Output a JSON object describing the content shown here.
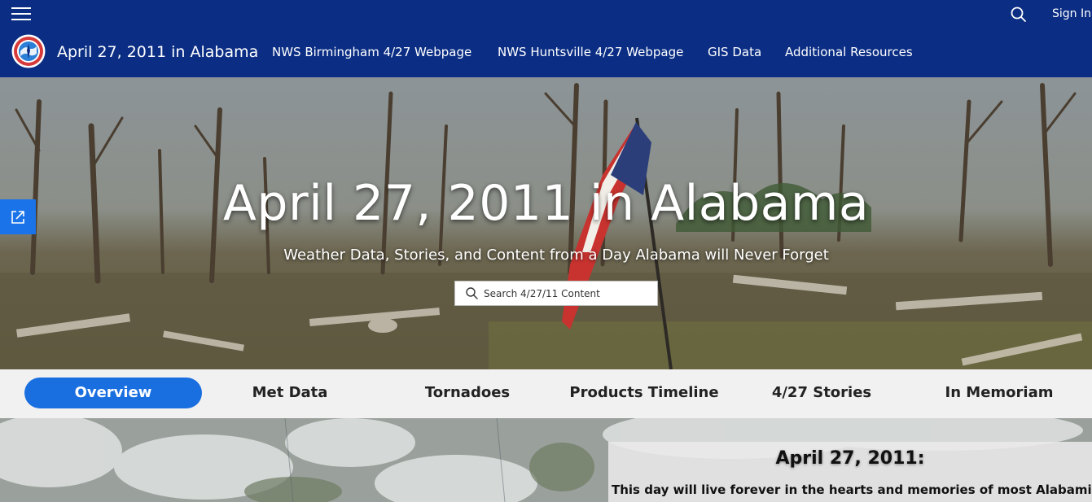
{
  "topbar": {
    "signin_label": "Sign In",
    "menu_icon": "hamburger-menu-icon",
    "search_icon": "search-icon"
  },
  "nav": {
    "logo_icon": "nws-logo",
    "site_title": "April 27, 2011 in Alabama",
    "links": [
      {
        "label": "NWS Birmingham 4/27 Webpage"
      },
      {
        "label": "NWS Huntsville 4/27 Webpage"
      },
      {
        "label": "GIS Data"
      },
      {
        "label": "Additional Resources"
      }
    ]
  },
  "hero": {
    "title": "April 27, 2011 in Alabama",
    "subtitle": "Weather Data, Stories, and Content from a Day Alabama will Never Forget",
    "search_placeholder": "Search 4/27/11 Content",
    "share_icon": "share-icon"
  },
  "tabs": [
    {
      "label": "Overview",
      "active": true
    },
    {
      "label": "Met Data",
      "active": false
    },
    {
      "label": "Tornadoes",
      "active": false
    },
    {
      "label": "Products Timeline",
      "active": false
    },
    {
      "label": "4/27 Stories",
      "active": false
    },
    {
      "label": "In Memoriam",
      "active": false
    }
  ],
  "content": {
    "card_title": "April 27, 2011:",
    "card_text": "This day will live forever in the hearts and memories of most Alabamians,"
  },
  "colors": {
    "header_bg": "#0b2e84",
    "accent": "#1a6fe0",
    "tabs_bg": "#f1f1f1"
  }
}
